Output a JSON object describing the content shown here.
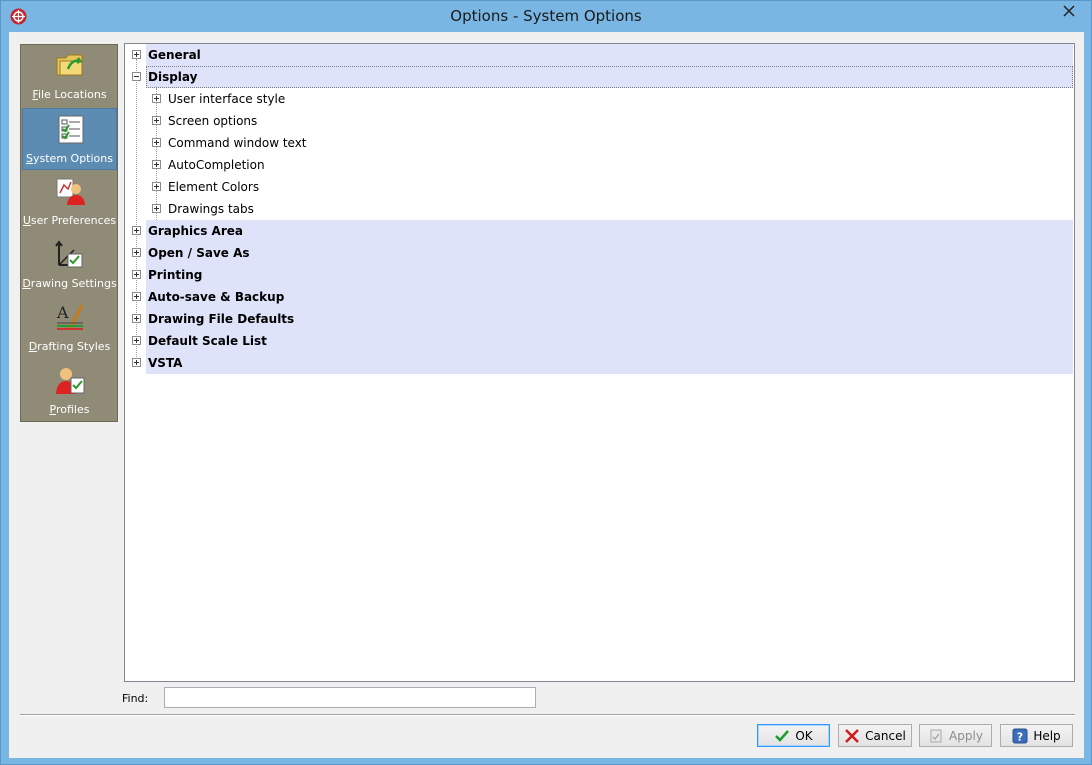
{
  "window": {
    "title": "Options - System Options"
  },
  "nav": {
    "items": [
      {
        "label": "File Locations",
        "icon": "folder-icon",
        "selected": false
      },
      {
        "label": "System Options",
        "icon": "checklist-icon",
        "selected": true
      },
      {
        "label": "User Preferences",
        "icon": "user-preferences-icon",
        "selected": false
      },
      {
        "label": "Drawing Settings",
        "icon": "drawing-settings-icon",
        "selected": false
      },
      {
        "label": "Drafting Styles",
        "icon": "drafting-styles-icon",
        "selected": false
      },
      {
        "label": "Profiles",
        "icon": "profiles-icon",
        "selected": false
      }
    ]
  },
  "tree": {
    "items": [
      {
        "label": "General",
        "expanded": false
      },
      {
        "label": "Display",
        "expanded": true,
        "children": [
          "User interface style",
          "Screen options",
          "Command window text",
          "AutoCompletion",
          "Element Colors",
          "Drawings tabs"
        ]
      },
      {
        "label": "Graphics Area",
        "expanded": false
      },
      {
        "label": "Open / Save As",
        "expanded": false
      },
      {
        "label": "Printing",
        "expanded": false
      },
      {
        "label": "Auto-save & Backup",
        "expanded": false
      },
      {
        "label": "Drawing File Defaults",
        "expanded": false
      },
      {
        "label": "Default Scale List",
        "expanded": false
      },
      {
        "label": "VSTA",
        "expanded": false
      }
    ]
  },
  "find": {
    "label": "Find:",
    "value": ""
  },
  "buttons": {
    "ok": "OK",
    "cancel": "Cancel",
    "apply": "Apply",
    "help": "Help"
  },
  "colors": {
    "titlebar": "#79b6e3",
    "nav_bg": "#908b76",
    "nav_selected": "#5d8cb3",
    "category_band": "#dfe3fa"
  }
}
